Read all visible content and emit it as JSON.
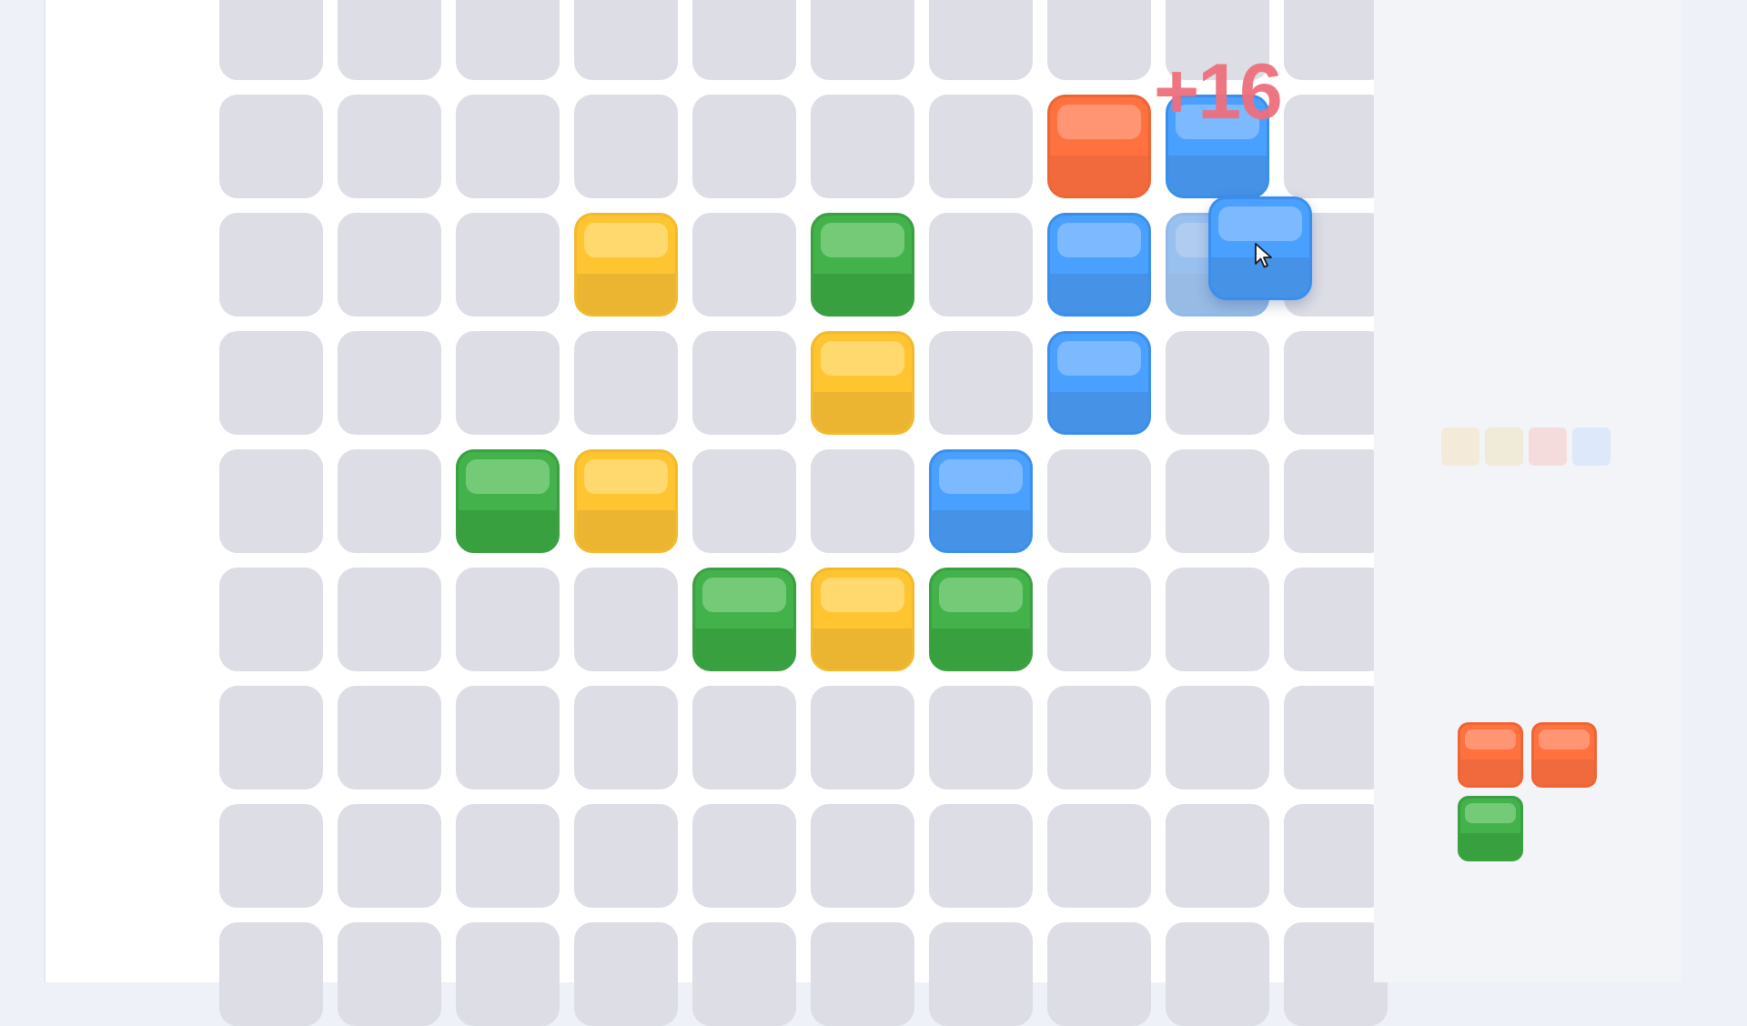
{
  "game": {
    "score_popup": "+16",
    "board_grid": {
      "columns": 10,
      "rows": 9
    },
    "placed_tiles": [
      {
        "row": 1,
        "col": 7,
        "color": "orange"
      },
      {
        "row": 1,
        "col": 8,
        "color": "blue"
      },
      {
        "row": 2,
        "col": 3,
        "color": "yellow"
      },
      {
        "row": 2,
        "col": 5,
        "color": "green"
      },
      {
        "row": 2,
        "col": 7,
        "color": "blue"
      },
      {
        "row": 2,
        "col": 8,
        "color": "blue",
        "ghost": true
      },
      {
        "row": 3,
        "col": 5,
        "color": "yellow"
      },
      {
        "row": 3,
        "col": 7,
        "color": "blue"
      },
      {
        "row": 4,
        "col": 2,
        "color": "green"
      },
      {
        "row": 4,
        "col": 3,
        "color": "yellow"
      },
      {
        "row": 4,
        "col": 6,
        "color": "blue"
      },
      {
        "row": 5,
        "col": 4,
        "color": "green"
      },
      {
        "row": 5,
        "col": 5,
        "color": "yellow"
      },
      {
        "row": 5,
        "col": 6,
        "color": "green"
      }
    ],
    "dragging_tile_color": "blue",
    "palette_swatches": [
      "#f3ead9",
      "#f0ead8",
      "#f5dcdc",
      "#dde9fb"
    ],
    "next_piece": [
      {
        "color": "orange"
      },
      {
        "color": "orange"
      },
      {
        "color": "green"
      }
    ],
    "colors": {
      "blue": "#4aa0ff",
      "orange": "#ff7240",
      "green": "#43b24a",
      "yellow": "#ffc531",
      "empty_cell": "#dcdde5",
      "score_popup": "#ee6f7c"
    }
  }
}
